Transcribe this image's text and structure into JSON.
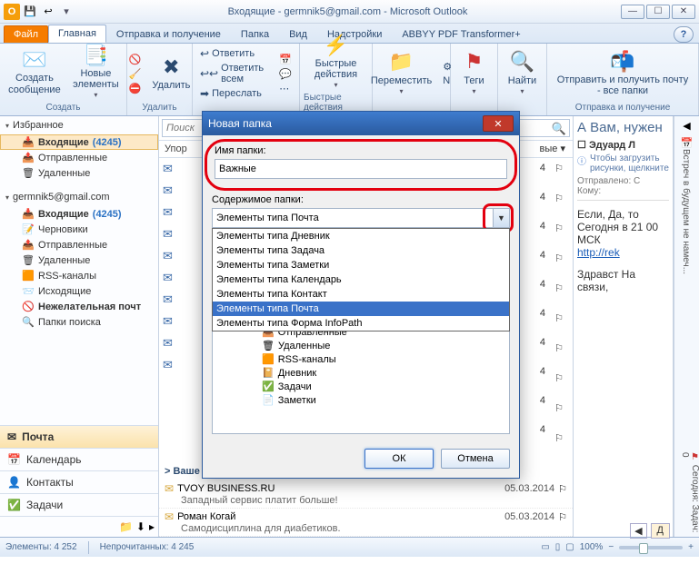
{
  "titlebar": {
    "title": "Входящие - germnik5@gmail.com - Microsoft Outlook",
    "controls": {
      "min": "—",
      "max": "☐",
      "close": "✕"
    }
  },
  "tabs": {
    "file": "Файл",
    "items": [
      "Главная",
      "Отправка и получение",
      "Папка",
      "Вид",
      "Надстройки",
      "ABBYY PDF Transformer+"
    ]
  },
  "ribbon": {
    "create": {
      "newmsg": "Создать сообщение",
      "newitems": "Новые элементы",
      "label": "Создать"
    },
    "delete": {
      "delete": "Удалить",
      "label": "Удалить"
    },
    "respond": {
      "reply": "Ответить",
      "replyall": "Ответить всем",
      "forward": "Переслать",
      "label": "..."
    },
    "quick": {
      "label": "Быстрые действия",
      "title": "Быстрые действия"
    },
    "move": {
      "move": "Переместить",
      "label": "..."
    },
    "tags": {
      "tags": "Теги",
      "label": "..."
    },
    "find": {
      "find": "Найти",
      "label": "..."
    },
    "sendrecv": {
      "title": "Отправить и получить почту - все папки",
      "label": "Отправка и получение"
    }
  },
  "nav": {
    "fav": "Избранное",
    "fav_items": [
      {
        "ic": "📥",
        "text": "Входящие",
        "count": "(4245)",
        "sel": true
      },
      {
        "ic": "📤",
        "text": "Отправленные"
      },
      {
        "ic": "🗑",
        "text": "Удаленные"
      }
    ],
    "account": "germnik5@gmail.com",
    "acct_items": [
      {
        "ic": "📥",
        "text": "Входящие",
        "count": "(4245)"
      },
      {
        "ic": "📝",
        "text": "Черновики"
      },
      {
        "ic": "📤",
        "text": "Отправленные"
      },
      {
        "ic": "🗑",
        "text": "Удаленные"
      },
      {
        "ic": "🟧",
        "text": "RSS-каналы"
      },
      {
        "ic": "📨",
        "text": "Исходящие"
      },
      {
        "ic": "🚫",
        "text": "Нежелательная почт",
        "bold": true
      },
      {
        "ic": "🔍",
        "text": "Папки поиска"
      }
    ],
    "bottom": [
      {
        "ic": "✉",
        "text": "Почта",
        "sel": true
      },
      {
        "ic": "📅",
        "text": "Календарь"
      },
      {
        "ic": "👤",
        "text": "Контакты"
      },
      {
        "ic": "✅",
        "text": "Задачи"
      }
    ]
  },
  "msglist": {
    "search_placeholder": "Поиск",
    "arrange": "Упор",
    "group": "> Ваше время уходит.",
    "visible_rows": [
      {
        "from": "TVOY BUSINESS.RU",
        "subj": "Западный сервис платит больше!",
        "date": "05.03.2014"
      },
      {
        "from": "Роман Когай",
        "subj": "Самодисциплина для диабетиков.",
        "date": "05.03.2014"
      }
    ],
    "truncated_rows_count": 10,
    "dates_behind": [
      "4",
      "4",
      "4",
      "4",
      "4",
      "4",
      "4",
      "4",
      "4",
      "4"
    ],
    "right_label": "вые"
  },
  "reading": {
    "subject": "А Вам, нужен",
    "from": "Эдуард Л",
    "info": "Чтобы загрузить рисунки, щелкните",
    "sent_label": "Отправлено:",
    "sent_value": "С",
    "to_label": "Кому:",
    "body1": "Если, Да, то Сегодня в 21 00 МСК",
    "link": "http://rek",
    "body2": "Здравст На связи,",
    "navbtn": "Д"
  },
  "todobar": {
    "text1": "Встреч в будущем не намеч...",
    "text2": "Сегодня: Задач: 0"
  },
  "dialog": {
    "title": "Новая папка",
    "name_label": "Имя папки:",
    "name_value": "Важные",
    "content_label": "Содержимое папки:",
    "combo_value": "Элементы типа Почта",
    "options": [
      "Элементы типа Дневник",
      "Элементы типа Задача",
      "Элементы типа Заметки",
      "Элементы типа Календарь",
      "Элементы типа Контакт",
      "Элементы типа Почта",
      "Элементы типа Форма InfoPath"
    ],
    "tree": [
      {
        "ic": "📤",
        "text": "Отправленные"
      },
      {
        "ic": "🗑",
        "text": "Удаленные"
      },
      {
        "ic": "🟧",
        "text": "RSS-каналы"
      },
      {
        "ic": "📔",
        "text": "Дневник"
      },
      {
        "ic": "✅",
        "text": "Задачи"
      },
      {
        "ic": "📄",
        "text": "Заметки"
      }
    ],
    "ok": "ОК",
    "cancel": "Отмена"
  },
  "statusbar": {
    "items": "Элементы: 4 252",
    "unread": "Непрочитанных: 4 245",
    "zoom": "100%"
  }
}
